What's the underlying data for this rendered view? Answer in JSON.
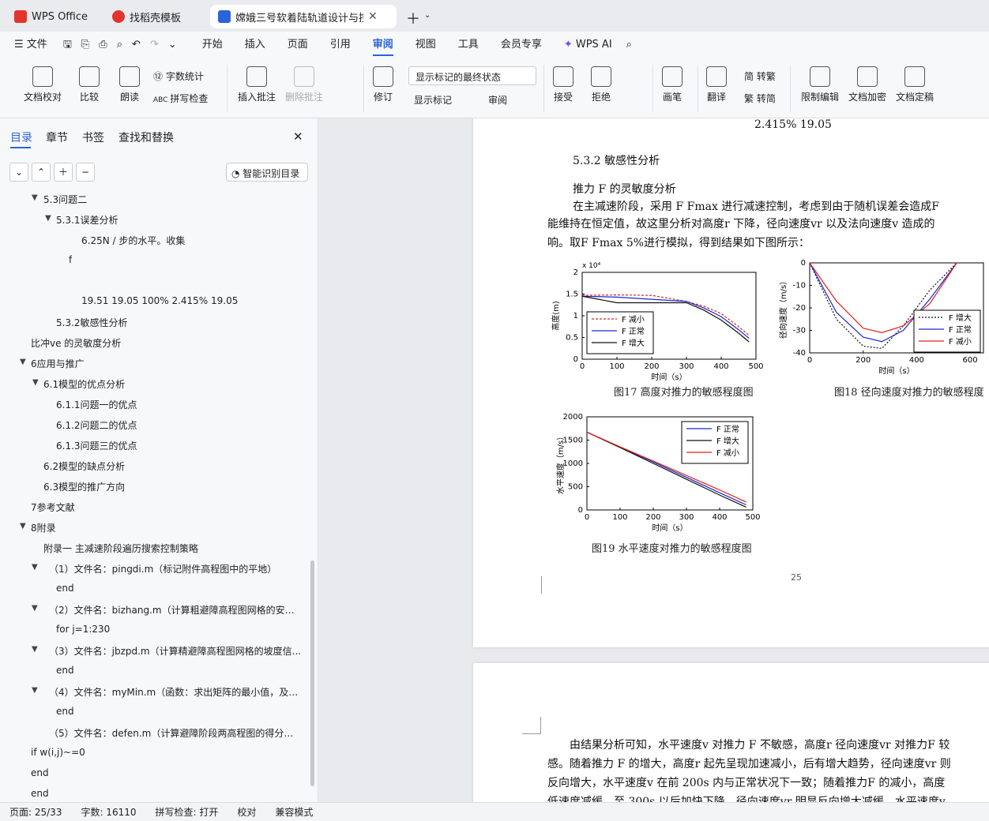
{
  "tabs": [
    {
      "label": "WPS Office"
    },
    {
      "label": "找稻壳模板"
    },
    {
      "label": "嫦娥三号软着陆轨道设计与控"
    }
  ],
  "menu": {
    "file": "文件",
    "items": [
      "开始",
      "插入",
      "页面",
      "引用",
      "审阅",
      "视图",
      "工具",
      "会员专享"
    ],
    "wps_ai": "WPS AI"
  },
  "ribbon": {
    "doc_check": "文档校对",
    "compare": "比较",
    "read_aloud": "朗读",
    "word_count": "字数统计",
    "spell_check": "拼写检查",
    "insert_comment": "插入批注",
    "delete_comment": "删除批注",
    "revise": "修订",
    "display_state": "显示标记的最终状态",
    "show_marks": "显示标记",
    "review": "审阅",
    "accept": "接受",
    "reject": "拒绝",
    "pen": "画笔",
    "translate": "翻译",
    "trad": "简 转繁",
    "simp": "繁 转简",
    "restrict_edit": "限制编辑",
    "encrypt": "文档加密",
    "finalize": "文档定稿"
  },
  "sidebar": {
    "tabs": [
      "目录",
      "章节",
      "书签",
      "查找和替换"
    ],
    "smart_toc": "智能识别目录",
    "toc": [
      "5.3问题二",
      "5.3.1误差分析",
      "6.25N / 步的水平。收集",
      "f",
      "19.51    19.05     100%     2.415% 19.05",
      "5.3.2敏感性分析",
      "比冲ve 的灵敏度分析",
      "6应用与推广",
      "6.1模型的优点分析",
      "6.1.1问题一的优点",
      "6.1.2问题二的优点",
      "6.1.3问题三的优点",
      "6.2模型的缺点分析",
      "6.3模型的推广方向",
      "7参考文献",
      "8附录",
      "附录一 主减速阶段遍历搜索控制策略",
      "（1）文件名：pingdi.m（标记附件高程图中的平地）",
      "end",
      "（2）文件名：bizhang.m（计算粗避障高程图网格的安全...",
      "for j=1:230",
      "（3）文件名：jbzpd.m（计算精避障高程图网格的坡度信...",
      "end",
      "（4）文件名：myMin.m（函数：求出矩阵的最小值，及其...",
      "end",
      "（5）文件名：defen.m（计算避障阶段两高程图的得分，...",
      "if w(i,j)~=0",
      "end",
      "end"
    ]
  },
  "doc": {
    "top_line": "2.415% 19.05",
    "heading": "5.3.2    敏感性分析",
    "p1": "推力 F 的灵敏度分析",
    "p2": "在主减速阶段，采用 F      Fmax 进行减速控制，考虑到由于随机误差会造成F",
    "p3": "能维持在恒定值，故这里分析对高度r 下降，径向速度vr 以及法向速度v  造成的",
    "p4": "响。取F        Fmax   5%进行模拟，得到结果如下图所示：",
    "page_num": "25",
    "q1": "由结果分析可知，水平速度v   对推力 F 不敏感，高度r 径向速度vr 对推力F 较",
    "q2": "感。随着推力 F 的增大，高度r 起先呈现加速减小，后有增大趋势，径向速度vr 则",
    "q3": "反向增大，水平速度v   在前 200s 内与正常状况下一致；随着推力F 的减小，高度",
    "q4": "低速度减缓，至 300s 以后加快下降，径向速度vr 明显反向增大减缓，水平速度v"
  },
  "chart_data": [
    {
      "type": "line",
      "title": "图17 高度对推力的敏感程度图",
      "xlabel": "时间（s）",
      "ylabel": "高度(m)",
      "y_multiplier": "x 10⁴",
      "xlim": [
        0,
        500
      ],
      "ylim": [
        0,
        2
      ],
      "xticks": [
        0,
        100,
        200,
        300,
        400,
        500
      ],
      "yticks": [
        0,
        0.5,
        1,
        1.5,
        2
      ],
      "legend": "inside-left",
      "x": [
        0,
        100,
        200,
        300,
        350,
        400,
        450,
        480
      ],
      "series": [
        {
          "name": "F 减小",
          "color": "#e02020",
          "dash": "3,2",
          "values": [
            1.47,
            1.48,
            1.47,
            1.33,
            1.22,
            1.05,
            0.75,
            0.55
          ]
        },
        {
          "name": "F 正常",
          "color": "#1a2ad0",
          "values": [
            1.45,
            1.43,
            1.38,
            1.33,
            1.18,
            0.98,
            0.68,
            0.48
          ]
        },
        {
          "name": "F 增大",
          "color": "#111111",
          "values": [
            1.45,
            1.3,
            1.3,
            1.3,
            1.13,
            0.9,
            0.6,
            0.4
          ]
        }
      ]
    },
    {
      "type": "line",
      "title": "图18 径向速度对推力的敏感程度",
      "xlabel": "时间（s）",
      "ylabel": "径向速度（m/s）",
      "xlim": [
        0,
        650
      ],
      "ylim": [
        -40,
        0
      ],
      "xticks": [
        0,
        200,
        400,
        600
      ],
      "yticks": [
        0,
        -10,
        -20,
        -30,
        -40
      ],
      "legend": "inside-right",
      "x": [
        0,
        100,
        200,
        270,
        350,
        450,
        550
      ],
      "series": [
        {
          "name": "F 增大",
          "color": "#111111",
          "dash": "2,2",
          "values": [
            0,
            -25,
            -37,
            -38,
            -28,
            -12,
            0
          ]
        },
        {
          "name": "F 正常",
          "color": "#1a2ad0",
          "values": [
            0,
            -22,
            -33,
            -35,
            -30,
            -16,
            0
          ]
        },
        {
          "name": "F 减小",
          "color": "#e02020",
          "values": [
            0,
            -17,
            -29,
            -31,
            -28,
            -18,
            0
          ]
        }
      ]
    },
    {
      "type": "line",
      "title": "图19 水平速度对推力的敏感程度图",
      "xlabel": "时间（s）",
      "ylabel": "水平速度（m/s）",
      "xlim": [
        0,
        500
      ],
      "ylim": [
        0,
        2000
      ],
      "xticks": [
        0,
        100,
        200,
        300,
        400,
        500
      ],
      "yticks": [
        0,
        500,
        1000,
        1500,
        2000
      ],
      "legend": "top-right",
      "x": [
        0,
        100,
        200,
        300,
        400,
        480
      ],
      "series": [
        {
          "name": "F 正常",
          "color": "#1a2ad0",
          "values": [
            1670,
            1350,
            1030,
            700,
            370,
            110
          ]
        },
        {
          "name": "F 增大",
          "color": "#111111",
          "values": [
            1670,
            1340,
            1000,
            660,
            320,
            60
          ]
        },
        {
          "name": "F 减小",
          "color": "#e02020",
          "values": [
            1670,
            1355,
            1050,
            740,
            430,
            170
          ]
        }
      ]
    }
  ],
  "status": {
    "page": "页面: 25/33",
    "words": "字数: 16110",
    "spell": "拼写检查: 打开",
    "proof": "校对",
    "compat": "兼容模式"
  }
}
